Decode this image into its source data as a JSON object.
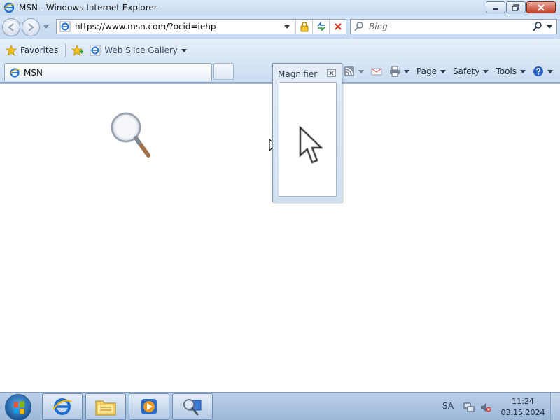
{
  "window": {
    "title": "MSN - Windows Internet Explorer"
  },
  "nav": {
    "address_url": "https://www.msn.com/?ocid=iehp",
    "search_placeholder": "Bing"
  },
  "favorites_bar": {
    "favorites_label": "Favorites",
    "web_slice_label": "Web Slice Gallery"
  },
  "tabs": [
    {
      "label": "MSN"
    }
  ],
  "command_bar": {
    "page_label": "Page",
    "safety_label": "Safety",
    "tools_label": "Tools"
  },
  "magnifier": {
    "title": "Magnifier"
  },
  "taskbar": {
    "lang": "SA",
    "time": "11:24",
    "date": "03.15.2024"
  },
  "icons": [
    "ie-icon",
    "back-icon",
    "forward-icon",
    "lock-icon",
    "refresh-icon",
    "stop-icon",
    "search-icon",
    "star-icon",
    "add-favorites-icon",
    "rss-icon",
    "mail-icon",
    "print-icon",
    "help-icon",
    "magnifier-lens-icon",
    "cursor-icon",
    "explorer-icon",
    "media-player-icon",
    "network-icon",
    "volume-muted-icon"
  ],
  "colors": {
    "titlebar": "#cfe0f3",
    "content": "#ffffff",
    "close_button": "#c2402a",
    "start_orb": "#1c5a9a"
  }
}
